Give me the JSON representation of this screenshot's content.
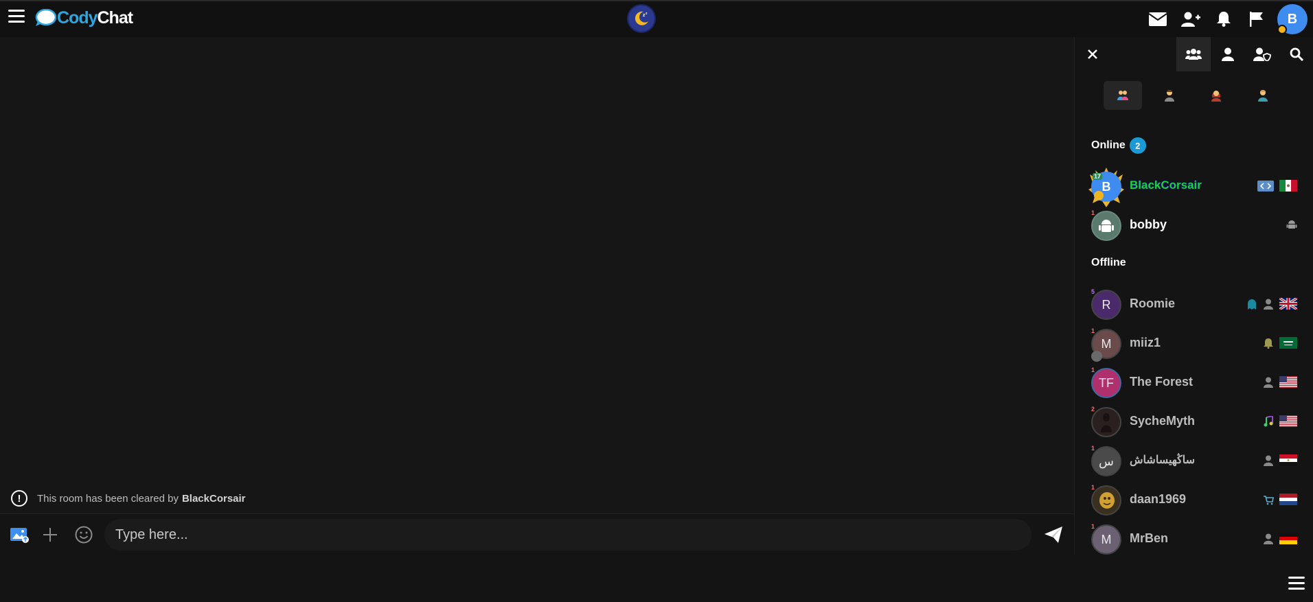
{
  "app": {
    "logo_part1": "Cody",
    "logo_part2": "Chat",
    "avatar_letter": "B"
  },
  "system_message": {
    "text": "This room has been cleared by",
    "user": "BlackCorsair"
  },
  "composer": {
    "placeholder": "Type here..."
  },
  "sidebar": {
    "online_title": "Online",
    "online_count": "2",
    "offline_title": "Offline",
    "online_users": [
      {
        "name": "BlackCorsair",
        "avatar_letter": "B",
        "rank": "17",
        "avatar_color": "#3f8cf0",
        "flag": "mexico",
        "icons": [
          "code-badge-icon"
        ]
      },
      {
        "name": "bobby",
        "avatar_letter": "",
        "rank": "1",
        "avatar_color": "#5a7a6e",
        "icons": [
          "android-icon"
        ]
      }
    ],
    "offline_users": [
      {
        "name": "Roomie",
        "avatar_letter": "R",
        "rank": "5",
        "avatar_color": "#4a2a6a",
        "flag": "uk",
        "icons": [
          "ghost-icon",
          "user-icon"
        ]
      },
      {
        "name": "miiz1",
        "avatar_letter": "M",
        "rank": "1",
        "avatar_color": "#6a4a4a",
        "flag": "saudi",
        "icons": [
          "bell-icon"
        ]
      },
      {
        "name": "The Forest",
        "avatar_letter": "TF",
        "rank": "1",
        "avatar_color": "#b0306e",
        "flag": "usa",
        "icons": [
          "user-icon"
        ]
      },
      {
        "name": "SycheMyth",
        "avatar_letter": "",
        "rank": "2",
        "avatar_color": "#2a2020",
        "flag": "usa",
        "icons": [
          "music-icon"
        ]
      },
      {
        "name": "ساڭهيساشاش",
        "avatar_letter": "س",
        "rank": "1",
        "avatar_color": "#4a4a4a",
        "flag": "egypt",
        "icons": [
          "user-icon"
        ]
      },
      {
        "name": "daan1969",
        "avatar_letter": "",
        "rank": "1",
        "avatar_color": "#7a5a1a",
        "flag": "netherlands",
        "icons": [
          "cart-icon"
        ]
      },
      {
        "name": "MrBen",
        "avatar_letter": "M",
        "rank": "1",
        "avatar_color": "#6b6172",
        "flag": "germany",
        "icons": [
          "user-icon"
        ]
      }
    ]
  },
  "colors": {
    "accent": "#1a9ad6",
    "brand_blue": "#2ea6e0",
    "background": "#161616"
  }
}
